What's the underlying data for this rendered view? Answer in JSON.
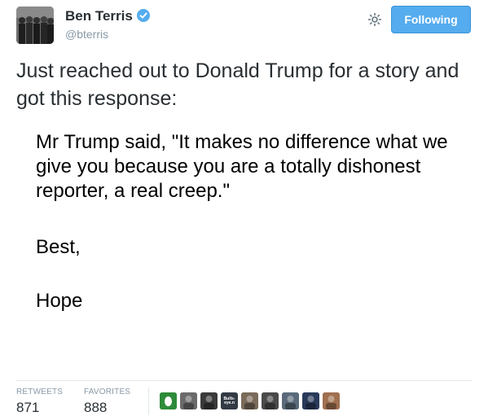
{
  "user": {
    "name": "Ben Terris",
    "handle": "@bterris"
  },
  "follow_button": {
    "label": "Following"
  },
  "tweet": {
    "text": "Just reached out to Donald Trump for a story and got this response:",
    "quote": "Mr Trump said, \"It makes no difference what we give you because you are a totally dishonest reporter, a real creep.\"",
    "sign_off": "Best,",
    "signature": "Hope"
  },
  "stats": {
    "retweets_label": "RETWEETS",
    "retweets_value": "871",
    "favorites_label": "FAVORITES",
    "favorites_value": "888"
  },
  "favoriters": [
    {
      "name": "favoriter-1",
      "color": "#2e8b3a",
      "text": ""
    },
    {
      "name": "favoriter-2",
      "color": "#6b6b6b",
      "text": ""
    },
    {
      "name": "favoriter-3",
      "color": "#3a3a3a",
      "text": ""
    },
    {
      "name": "favoriter-4",
      "color": "#333a44",
      "text": "Bulls-eye.n"
    },
    {
      "name": "favoriter-5",
      "color": "#7a6a5a",
      "text": ""
    },
    {
      "name": "favoriter-6",
      "color": "#4a4a4a",
      "text": ""
    },
    {
      "name": "favoriter-7",
      "color": "#5a6a7a",
      "text": ""
    },
    {
      "name": "favoriter-8",
      "color": "#2a3a5a",
      "text": ""
    },
    {
      "name": "favoriter-9",
      "color": "#a07050",
      "text": ""
    }
  ],
  "colors": {
    "accent": "#55acee",
    "verified": "#55acee",
    "muted": "#8899a6",
    "text": "#292f33"
  }
}
